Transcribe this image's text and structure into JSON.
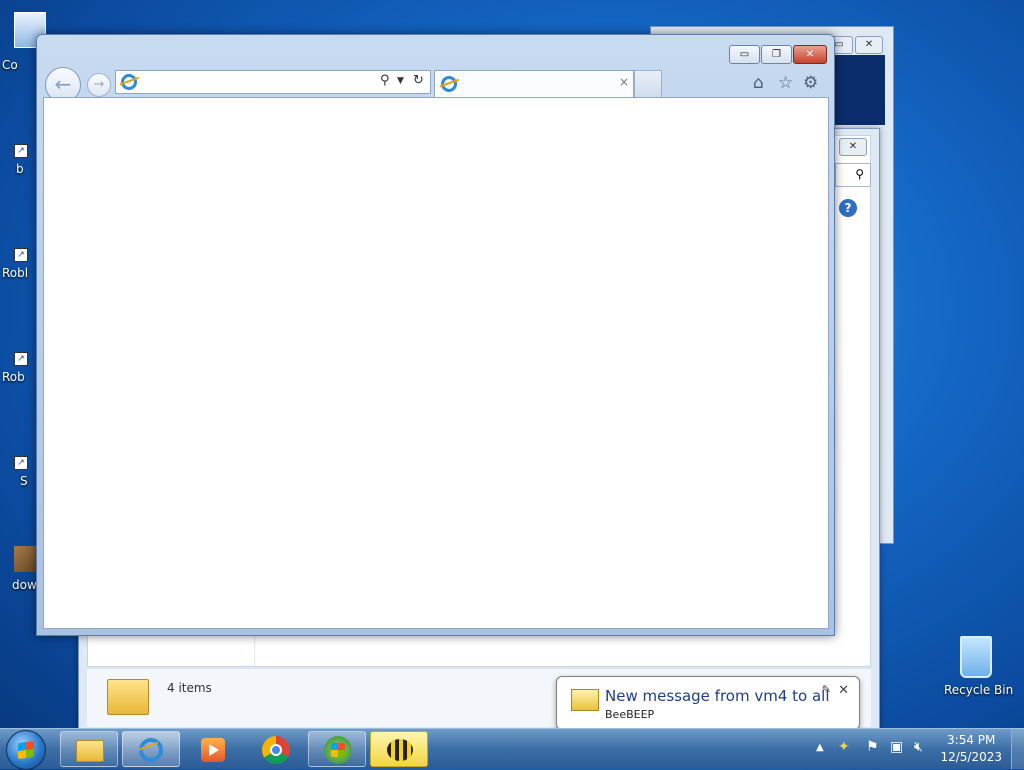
{
  "desktop": {
    "icons": [
      {
        "label": "Co"
      },
      {
        "label": "b"
      },
      {
        "label": "Robl"
      },
      {
        "label": "Rob"
      },
      {
        "label": "S"
      },
      {
        "label": "dow"
      }
    ],
    "recycle_bin": {
      "label": "Recycle Bin"
    }
  },
  "background_window": {
    "status_text": "4 items"
  },
  "ie": {
    "address": {
      "value": ""
    },
    "tab": {
      "title": "",
      "close": "×"
    },
    "caption": {
      "minimize": "▭",
      "maximize": "❐",
      "close": "✕"
    }
  },
  "notification": {
    "title": "New message from vm4 to all",
    "app": "BeeBEEP",
    "close": "✕"
  },
  "taskbar": {
    "clock": {
      "time": "3:54 PM",
      "date": "12/5/2023"
    },
    "buttons": [
      "windows-explorer",
      "internet-explorer",
      "media-player",
      "chrome",
      "windows",
      "beebeep"
    ]
  },
  "colors": {
    "accent": "#1466c4",
    "close_red": "#c8412b"
  }
}
